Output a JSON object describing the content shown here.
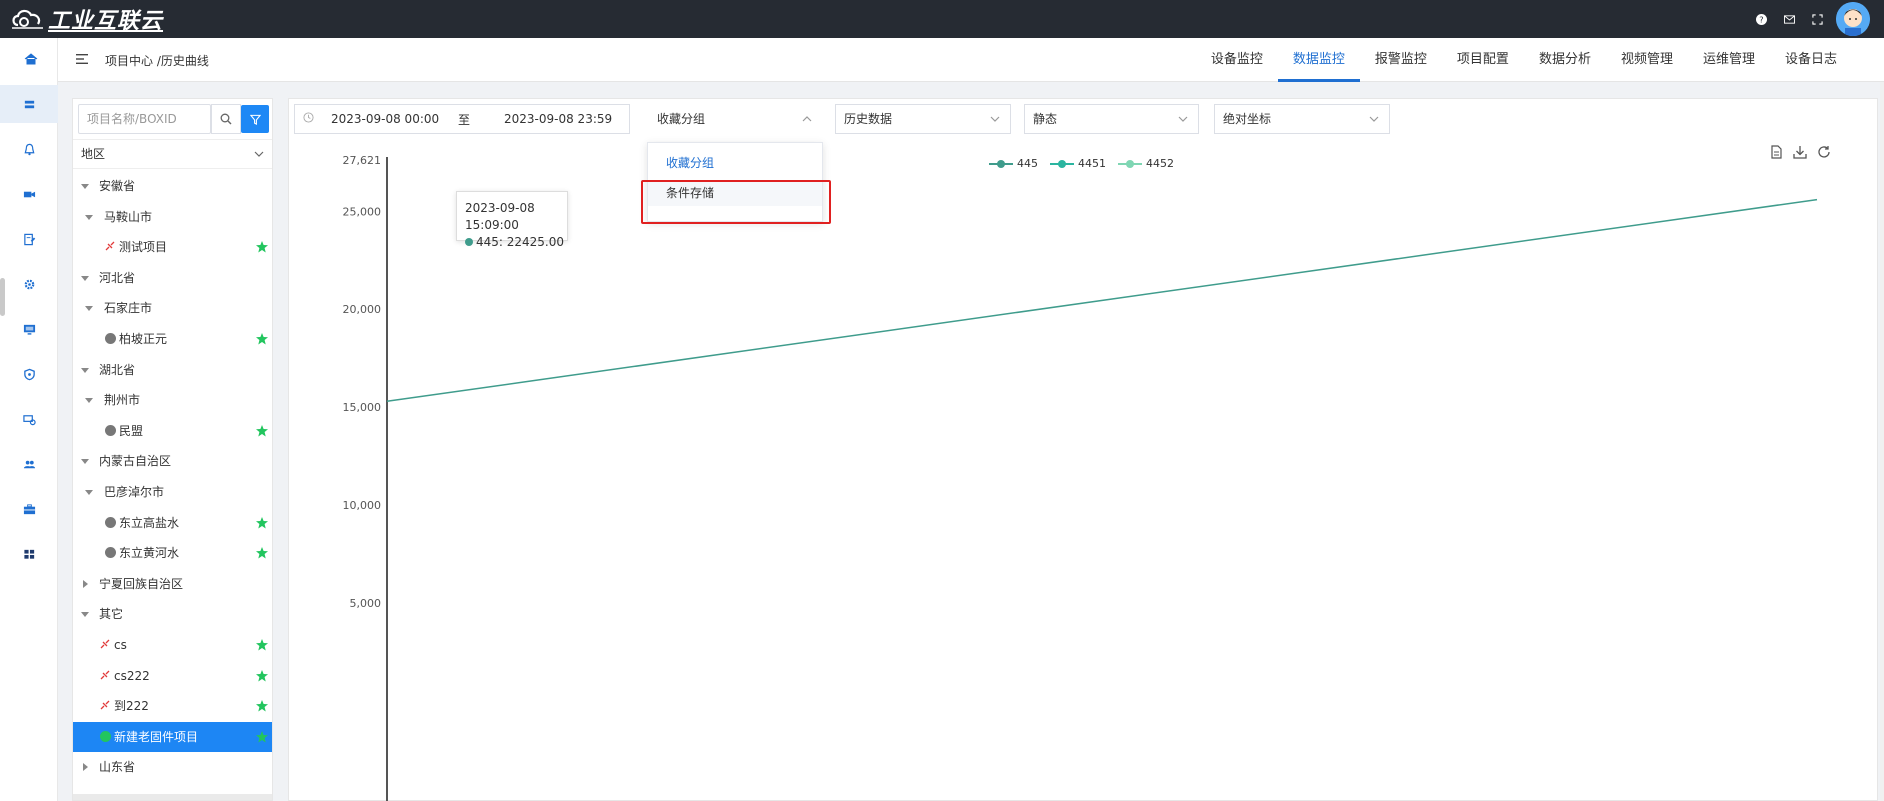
{
  "app": {
    "logo_text": "工业互联云"
  },
  "breadcrumb": "项目中心 /历史曲线",
  "nav_tabs": [
    {
      "label": "设备监控",
      "active": false
    },
    {
      "label": "数据监控",
      "active": true
    },
    {
      "label": "报警监控",
      "active": false
    },
    {
      "label": "项目配置",
      "active": false
    },
    {
      "label": "数据分析",
      "active": false
    },
    {
      "label": "视频管理",
      "active": false
    },
    {
      "label": "运维管理",
      "active": false
    },
    {
      "label": "设备日志",
      "active": false
    }
  ],
  "rail_icons": [
    "layers-icon",
    "bell-icon",
    "video-icon",
    "edit-doc-icon",
    "gear-icon",
    "monitor-icon",
    "shield-icon",
    "camera-settings-icon",
    "users-icon",
    "briefcase-icon",
    "grid-icon"
  ],
  "tree": {
    "search_placeholder": "项目名称/BOXID",
    "region_label": "地区",
    "rows": [
      {
        "label": "安徽省",
        "level": 0,
        "expanded": true,
        "type": "node"
      },
      {
        "label": "马鞍山市",
        "level": 1,
        "expanded": true,
        "type": "node"
      },
      {
        "label": "测试项目",
        "level": 2,
        "type": "plug",
        "star": true
      },
      {
        "label": "河北省",
        "level": 0,
        "expanded": true,
        "type": "node"
      },
      {
        "label": "石家庄市",
        "level": 1,
        "expanded": true,
        "type": "node"
      },
      {
        "label": "柏坡正元",
        "level": 2,
        "type": "dot",
        "star": true
      },
      {
        "label": "湖北省",
        "level": 0,
        "expanded": true,
        "type": "node"
      },
      {
        "label": "荆州市",
        "level": 1,
        "expanded": true,
        "type": "node"
      },
      {
        "label": "民盟",
        "level": 2,
        "type": "dot",
        "star": true
      },
      {
        "label": "内蒙古自治区",
        "level": 0,
        "expanded": true,
        "type": "node"
      },
      {
        "label": "巴彦淖尔市",
        "level": 1,
        "expanded": true,
        "type": "node"
      },
      {
        "label": "东立高盐水",
        "level": 2,
        "type": "dot",
        "star": true
      },
      {
        "label": "东立黄河水",
        "level": 2,
        "type": "dot",
        "star": true
      },
      {
        "label": "宁夏回族自治区",
        "level": 0,
        "expanded": false,
        "type": "node"
      },
      {
        "label": "其它",
        "level": 0,
        "expanded": true,
        "type": "node"
      },
      {
        "label": "cs",
        "level": 1,
        "type": "plug",
        "star": true
      },
      {
        "label": "cs222",
        "level": 1,
        "type": "plug",
        "star": true
      },
      {
        "label": "到222",
        "level": 1,
        "type": "plug",
        "star": true
      },
      {
        "label": "新建老固件项目",
        "level": 1,
        "type": "dot-green",
        "star": true,
        "selected": true
      },
      {
        "label": "山东省",
        "level": 0,
        "expanded": false,
        "type": "node"
      }
    ]
  },
  "filters": {
    "date_start": "2023-09-08 00:00",
    "date_sep": "至",
    "date_end": "2023-09-08 23:59",
    "group_select": "收藏分组",
    "data_type": "历史数据",
    "mode": "静态",
    "coord": "绝对坐标"
  },
  "dropdown": {
    "items": [
      "收藏分组",
      "条件存储"
    ]
  },
  "tooltip": {
    "time": "2023-09-08 15:09:00",
    "value": "445: 22425.00"
  },
  "colors": {
    "accent": "#1f6fd1",
    "series_445": "#3f9c8c",
    "series_4451": "#2bb5a0",
    "series_4452": "#7fd6b3"
  },
  "chart_data": {
    "type": "line",
    "series": [
      {
        "name": "445",
        "x": [
          0,
          1
        ],
        "values": [
          15300,
          25600
        ]
      },
      {
        "name": "4451",
        "x": [],
        "values": []
      },
      {
        "name": "4452",
        "x": [],
        "values": []
      }
    ],
    "ylim": [
      0,
      27621
    ],
    "y_ticks": [
      "27,621",
      "25,000",
      "20,000",
      "15,000",
      "10,000",
      "5,000"
    ],
    "y_tick_values": [
      27621,
      25000,
      20000,
      15000,
      10000,
      5000
    ],
    "legend": "top-center"
  }
}
